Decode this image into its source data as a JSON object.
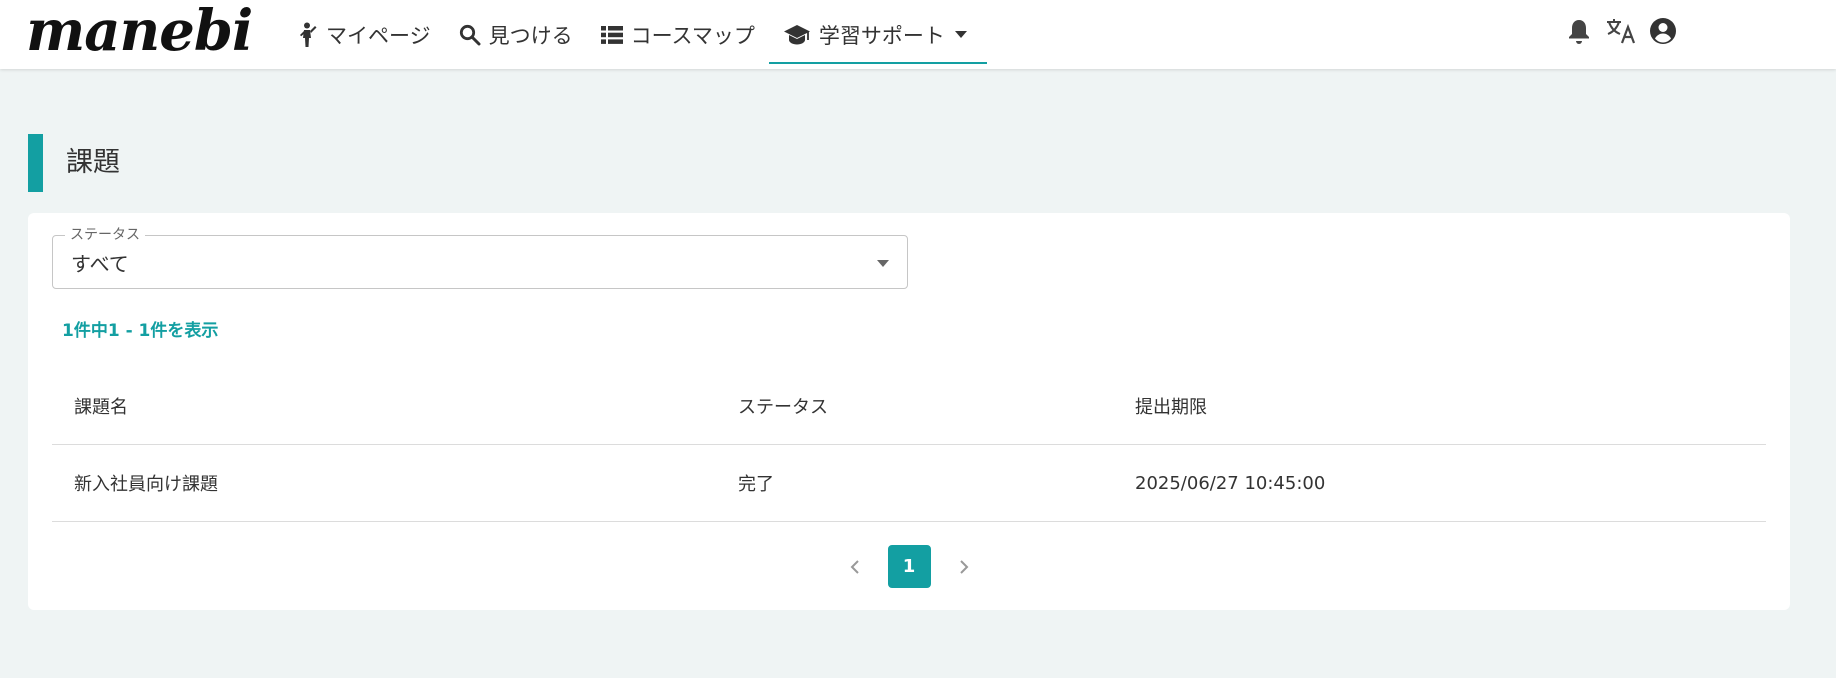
{
  "header": {
    "logo_text": "manebi",
    "nav": [
      {
        "label": "マイページ",
        "icon": "person-walking-icon"
      },
      {
        "label": "見つける",
        "icon": "search-icon"
      },
      {
        "label": "コースマップ",
        "icon": "list-icon"
      },
      {
        "label": "学習サポート",
        "icon": "graduation-cap-icon",
        "active": true
      }
    ],
    "icons": [
      "bell-icon",
      "translate-icon",
      "account-circle-icon"
    ]
  },
  "page": {
    "title": "課題"
  },
  "filter": {
    "legend": "ステータス",
    "value": "すべて"
  },
  "result_count": "1件中1 - 1件を表示",
  "table": {
    "columns": [
      "課題名",
      "ステータス",
      "提出期限"
    ],
    "rows": [
      {
        "name": "新入社員向け課題",
        "status": "完了",
        "deadline": "2025/06/27 10:45:00"
      }
    ]
  },
  "pagination": {
    "current": "1"
  },
  "colors": {
    "accent": "#139fa2",
    "background": "#eff4f4"
  }
}
